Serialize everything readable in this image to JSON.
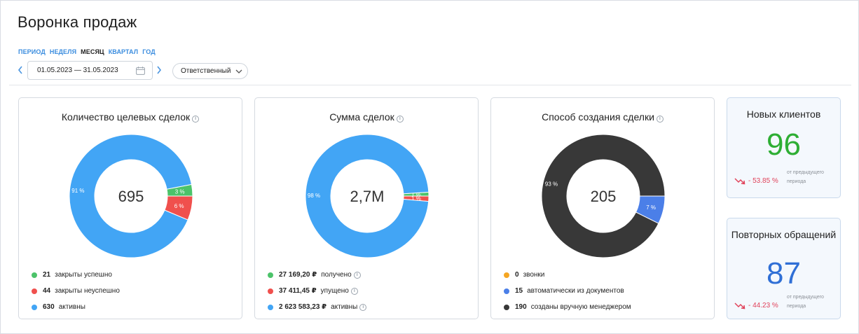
{
  "page": {
    "title": "Воронка продаж"
  },
  "period_tabs": [
    {
      "label": "ПЕРИОД",
      "active": false
    },
    {
      "label": "НЕДЕЛЯ",
      "active": false
    },
    {
      "label": "МЕСЯЦ",
      "active": true
    },
    {
      "label": "КВАРТАЛ",
      "active": false
    },
    {
      "label": "ГОД",
      "active": false
    }
  ],
  "date_range": {
    "value": "01.05.2023 — 31.05.2023",
    "prev_icon": "chevron-left-icon",
    "next_icon": "chevron-right-icon",
    "calendar_icon": "calendar-icon"
  },
  "filter": {
    "label": "Ответственный"
  },
  "cards": [
    {
      "title": "Количество целевых сделок",
      "center": "695",
      "segments": [
        {
          "label": "3 %",
          "value": 21,
          "color": "#4cc36a"
        },
        {
          "label": "6 %",
          "value": 44,
          "color": "#f0504d"
        },
        {
          "label": "91 %",
          "value": 630,
          "color": "#42a5f5"
        }
      ],
      "legend": [
        {
          "value": "21",
          "text": "закрыты успешно",
          "color": "#4cc36a",
          "info": false
        },
        {
          "value": "44",
          "text": "закрыты неуспешно",
          "color": "#f0504d",
          "info": false
        },
        {
          "value": "630",
          "text": "активны",
          "color": "#42a5f5",
          "info": false
        }
      ]
    },
    {
      "title": "Сумма сделок",
      "center": "2,7М",
      "segments": [
        {
          "label": "1 %",
          "value": 27169.2,
          "color": "#4cc36a"
        },
        {
          "label": "1 %",
          "value": 37411.45,
          "color": "#f0504d"
        },
        {
          "label": "98 %",
          "value": 2623583.23,
          "color": "#42a5f5"
        }
      ],
      "legend": [
        {
          "value": "27 169,20 ₽",
          "text": "получено",
          "color": "#4cc36a",
          "info": true
        },
        {
          "value": "37 411,45 ₽",
          "text": "упущено",
          "color": "#f0504d",
          "info": true
        },
        {
          "value": "2 623 583,23 ₽",
          "text": "активны",
          "color": "#42a5f5",
          "info": true
        }
      ]
    },
    {
      "title": "Способ создания сделки",
      "center": "205",
      "segments": [
        {
          "label": "",
          "value": 0,
          "color": "#f5a623"
        },
        {
          "label": "7 %",
          "value": 15,
          "color": "#4b7fe8"
        },
        {
          "label": "93 %",
          "value": 190,
          "color": "#383838"
        }
      ],
      "legend": [
        {
          "value": "0",
          "text": "звонки",
          "color": "#f5a623",
          "info": false
        },
        {
          "value": "15",
          "text": "автоматически из документов",
          "color": "#4b7fe8",
          "info": false
        },
        {
          "value": "190",
          "text": "созданы вручную менеджером",
          "color": "#383838",
          "info": false
        }
      ]
    }
  ],
  "stats": [
    {
      "title": "Новых клиентов",
      "value": "96",
      "color": "#2eae34",
      "change": "- 53.85 %",
      "note": "от предыдущего периода",
      "trend_icon": "trend-down-icon"
    },
    {
      "title": "Повторных обращений",
      "value": "87",
      "color": "#2f6fd6",
      "change": "- 44.23 %",
      "note": "от предыдущего периода",
      "trend_icon": "trend-down-icon"
    }
  ]
}
